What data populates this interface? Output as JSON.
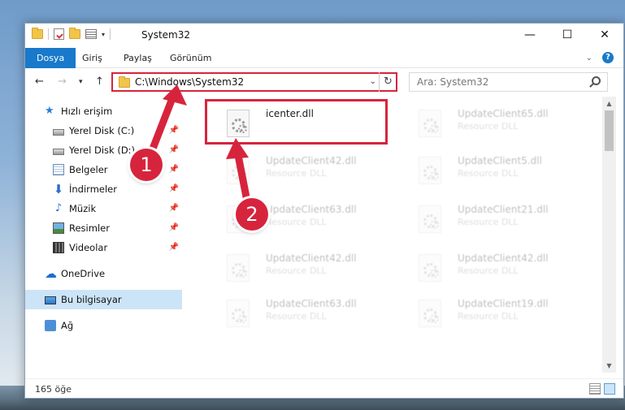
{
  "window": {
    "title": "System32",
    "minimize_glyph": "—",
    "maximize_glyph": "☐",
    "close_glyph": "✕"
  },
  "ribbon": {
    "tabs": [
      "Dosya",
      "Giriş",
      "Paylaş",
      "Görünüm"
    ],
    "help_label": "?"
  },
  "navigation": {
    "back_glyph": "←",
    "forward_glyph": "→",
    "recent_glyph": "▾",
    "up_glyph": "↑",
    "address": "C:\\Windows\\System32",
    "refresh_glyph": "↻",
    "search_placeholder": "Ara: System32"
  },
  "sidebar": {
    "items": [
      {
        "label": "Hızlı erişim",
        "icon": "star-icon"
      },
      {
        "label": "Yerel Disk (C:)",
        "icon": "drive-icon",
        "pinned": true
      },
      {
        "label": "Yerel Disk (D:)",
        "icon": "drive-icon",
        "pinned": true
      },
      {
        "label": "Belgeler",
        "icon": "documents-icon",
        "pinned": true
      },
      {
        "label": "İndirmeler",
        "icon": "downloads-icon",
        "pinned": true
      },
      {
        "label": "Müzik",
        "icon": "music-icon",
        "pinned": true
      },
      {
        "label": "Resimler",
        "icon": "pictures-icon",
        "pinned": true
      },
      {
        "label": "Videolar",
        "icon": "videos-icon",
        "pinned": true
      },
      {
        "label": "OneDrive",
        "icon": "onedrive-icon"
      },
      {
        "label": "Bu bilgisayar",
        "icon": "computer-icon",
        "selected": true
      },
      {
        "label": "Ağ",
        "icon": "network-icon"
      }
    ]
  },
  "files": [
    {
      "name": "icenter.dll",
      "type": "",
      "highlighted": true
    },
    {
      "name": "UpdateClient65.dll",
      "type": "Resource DLL"
    },
    {
      "name": "UpdateClient42.dll",
      "type": "Resource DLL"
    },
    {
      "name": "UpdateClient5.dll",
      "type": "Resource DLL"
    },
    {
      "name": "UpdateClient63.dll",
      "type": "Resource DLL"
    },
    {
      "name": "UpdateClient21.dll",
      "type": "Resource DLL"
    },
    {
      "name": "UpdateClient42.dll",
      "type": "Resource DLL"
    },
    {
      "name": "UpdateClient42.dll",
      "type": "Resource DLL"
    },
    {
      "name": "UpdateClient63.dll",
      "type": "Resource DLL"
    },
    {
      "name": "UpdateClient19.dll",
      "type": "Resource DLL"
    }
  ],
  "status": {
    "item_count": "165 öğe"
  },
  "annotations": {
    "step1": "1",
    "step2": "2",
    "color": "#d7243d"
  }
}
